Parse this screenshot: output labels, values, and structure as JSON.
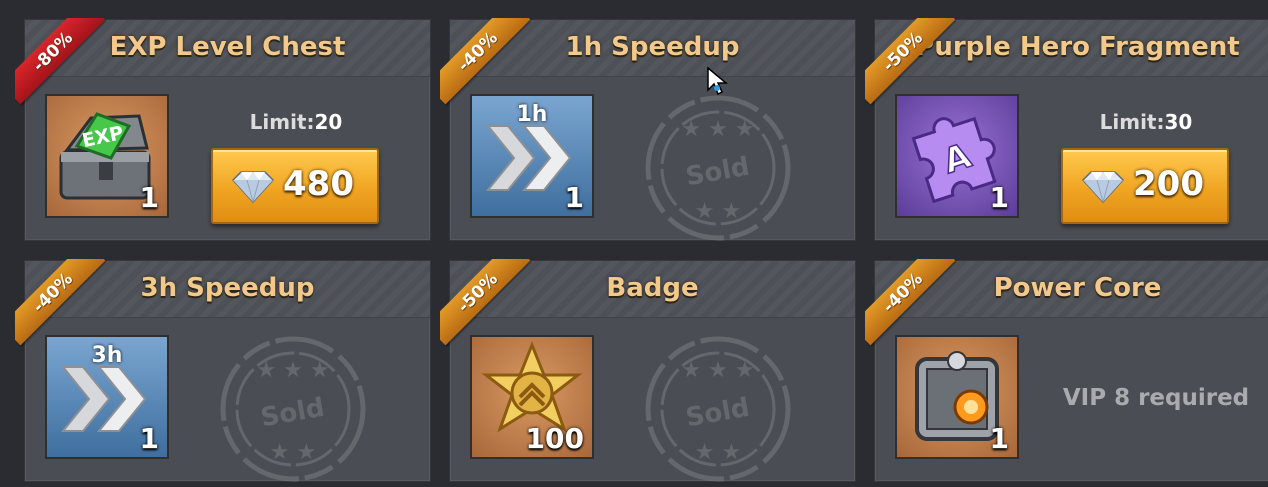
{
  "shop": {
    "items": [
      {
        "title": "EXP Level Chest",
        "discount": "-80%",
        "quantity": "1",
        "limit_label": "Limit:",
        "limit_value": "20",
        "price": "480",
        "icon": "exp-chest-icon"
      },
      {
        "title": "1h Speedup",
        "discount": "-40%",
        "quantity": "1",
        "duration": "1h",
        "stamp": "Sold",
        "icon": "speedup-icon"
      },
      {
        "title": "Purple Hero Fragment",
        "discount": "-50%",
        "quantity": "1",
        "limit_label": "Limit:",
        "limit_value": "30",
        "price": "200",
        "icon": "hero-fragment-icon"
      },
      {
        "title": "3h Speedup",
        "discount": "-40%",
        "quantity": "1",
        "duration": "3h",
        "stamp": "Sold",
        "icon": "speedup-icon"
      },
      {
        "title": "Badge",
        "discount": "-50%",
        "quantity": "100",
        "stamp": "Sold",
        "icon": "badge-icon"
      },
      {
        "title": "Power Core",
        "discount": "-40%",
        "quantity": "1",
        "requirement": "VIP 8 required",
        "icon": "power-core-icon"
      }
    ],
    "currency_icon": "diamond-icon"
  },
  "colors": {
    "title": "#f2c98a",
    "ribbon_orange": "#e29a28",
    "ribbon_red": "#d8262a",
    "button": "#f0a522",
    "card": "#4a4d53"
  }
}
